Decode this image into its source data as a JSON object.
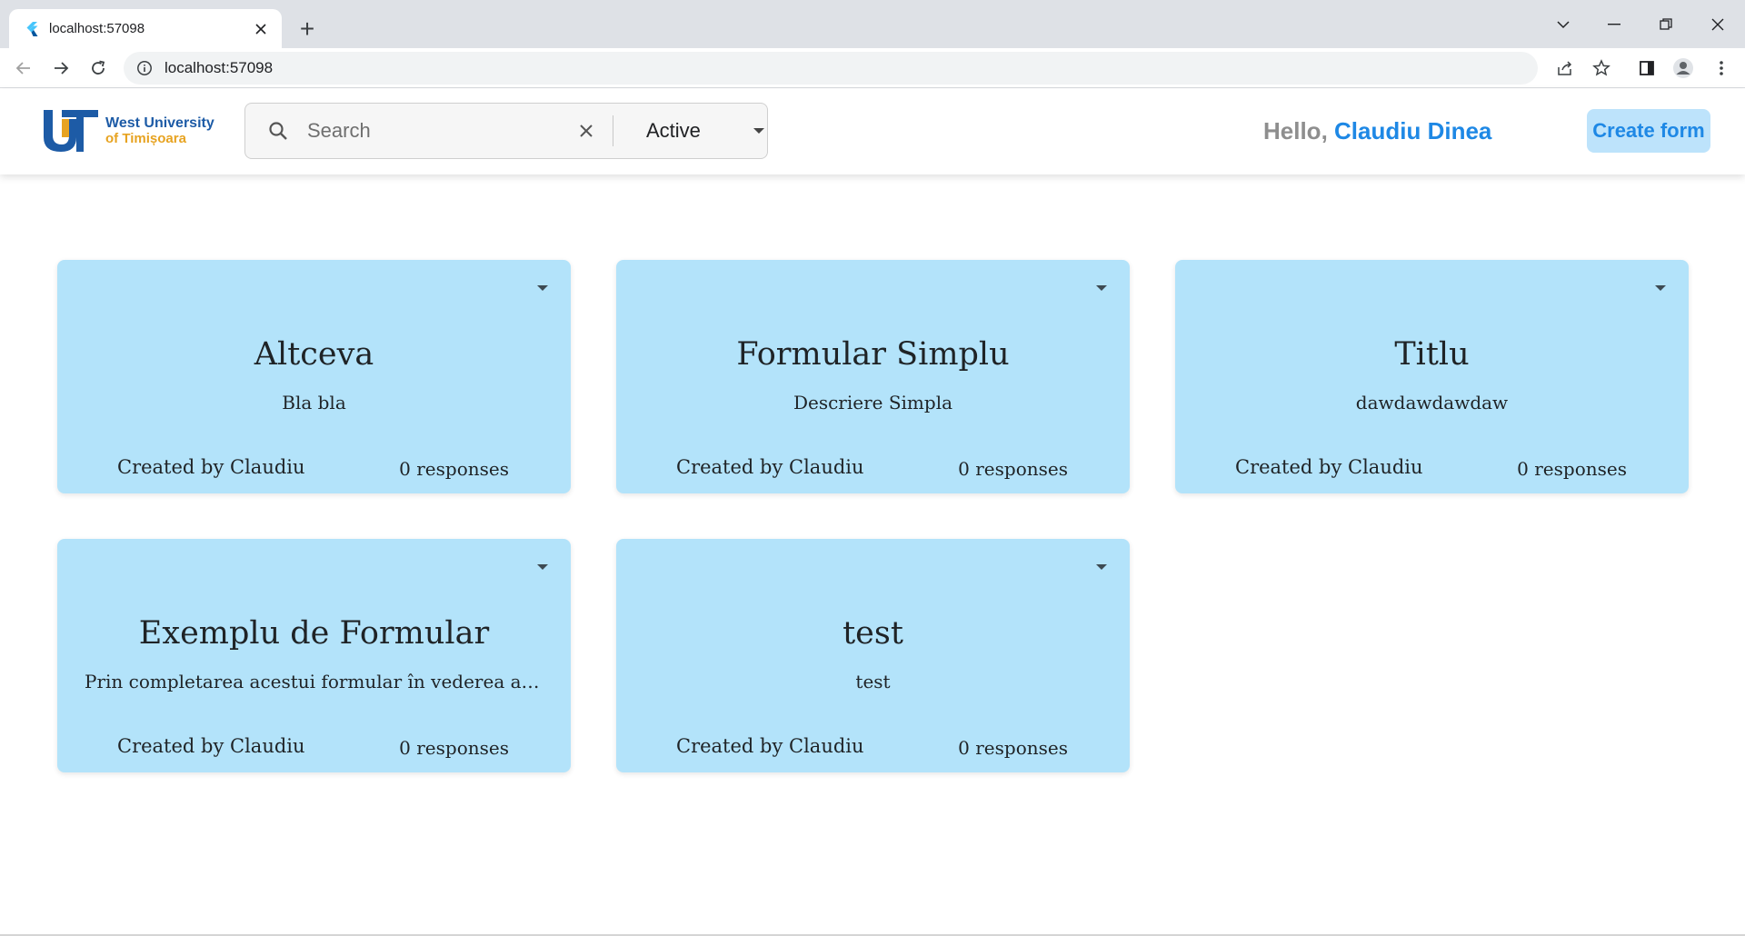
{
  "browser": {
    "tab_title": "localhost:57098",
    "new_tab_symbol": "+",
    "url": "localhost:57098",
    "tab_close_symbol": "✕"
  },
  "header": {
    "logo": {
      "line1": "West University",
      "line2": "of Timișoara"
    },
    "search": {
      "placeholder": "Search",
      "value": ""
    },
    "status_filter": "Active",
    "greeting_hello": "Hello,",
    "greeting_name": "Claudiu Dinea",
    "create_button": "Create form"
  },
  "colors": {
    "accent": "#1e88e5",
    "card_background": "#b3e3fa",
    "logo_blue": "#1d5ba6",
    "logo_gold": "#e7a321"
  },
  "cards": [
    {
      "title": "Altceva",
      "description": "Bla bla",
      "creator": "Created by Claudiu",
      "responses": "0 responses"
    },
    {
      "title": "Formular Simplu",
      "description": "Descriere Simpla",
      "creator": "Created by Claudiu",
      "responses": "0 responses"
    },
    {
      "title": "Titlu",
      "description": "dawdawdawdaw",
      "creator": "Created by Claudiu",
      "responses": "0 responses"
    },
    {
      "title": "Exemplu de Formular",
      "description": "Prin completarea acestui formular în vederea analizei informațiilor",
      "creator": "Created by Claudiu",
      "responses": "0 responses"
    },
    {
      "title": "test",
      "description": "test",
      "creator": "Created by Claudiu",
      "responses": "0 responses"
    }
  ]
}
